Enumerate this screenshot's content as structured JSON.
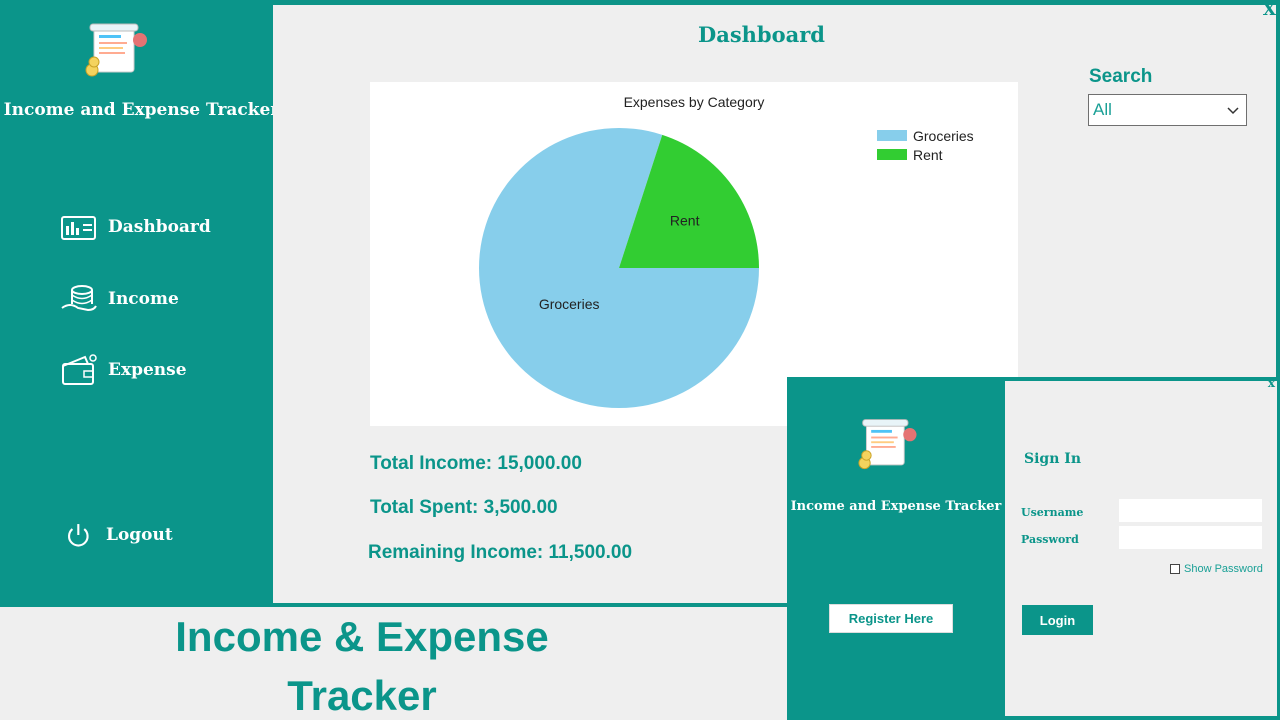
{
  "app": {
    "title": "Income and Expense Tracker"
  },
  "sidebar": {
    "items": [
      {
        "label": "Dashboard",
        "icon": "dashboard-icon"
      },
      {
        "label": "Income",
        "icon": "coins-icon"
      },
      {
        "label": "Expense",
        "icon": "wallet-icon"
      }
    ],
    "logout_label": "Logout"
  },
  "window": {
    "close_label": "X"
  },
  "main": {
    "title": "Dashboard",
    "search": {
      "label": "Search",
      "value": "All"
    },
    "stats": {
      "total_income": "Total Income: 15,000.00",
      "total_spent": "Total Spent: 3,500.00",
      "remaining": "Remaining Income: 11,500.00"
    }
  },
  "chart_data": {
    "type": "pie",
    "title": "Expenses by Category",
    "categories": [
      "Groceries",
      "Rent"
    ],
    "values": [
      80,
      20
    ],
    "colors": [
      "#87ceeb",
      "#32cd32"
    ],
    "legend_position": "top-right"
  },
  "caption": {
    "line1": "Income & Expense",
    "line2": "Tracker"
  },
  "login": {
    "app_title": "Income and Expense Tracker",
    "register_label": "Register Here",
    "heading": "Sign In",
    "username_label": "Username",
    "password_label": "Password",
    "show_password_label": "Show Password",
    "login_label": "Login",
    "close_label": "x"
  },
  "colors": {
    "accent": "#0b958a",
    "background": "#efefef"
  }
}
